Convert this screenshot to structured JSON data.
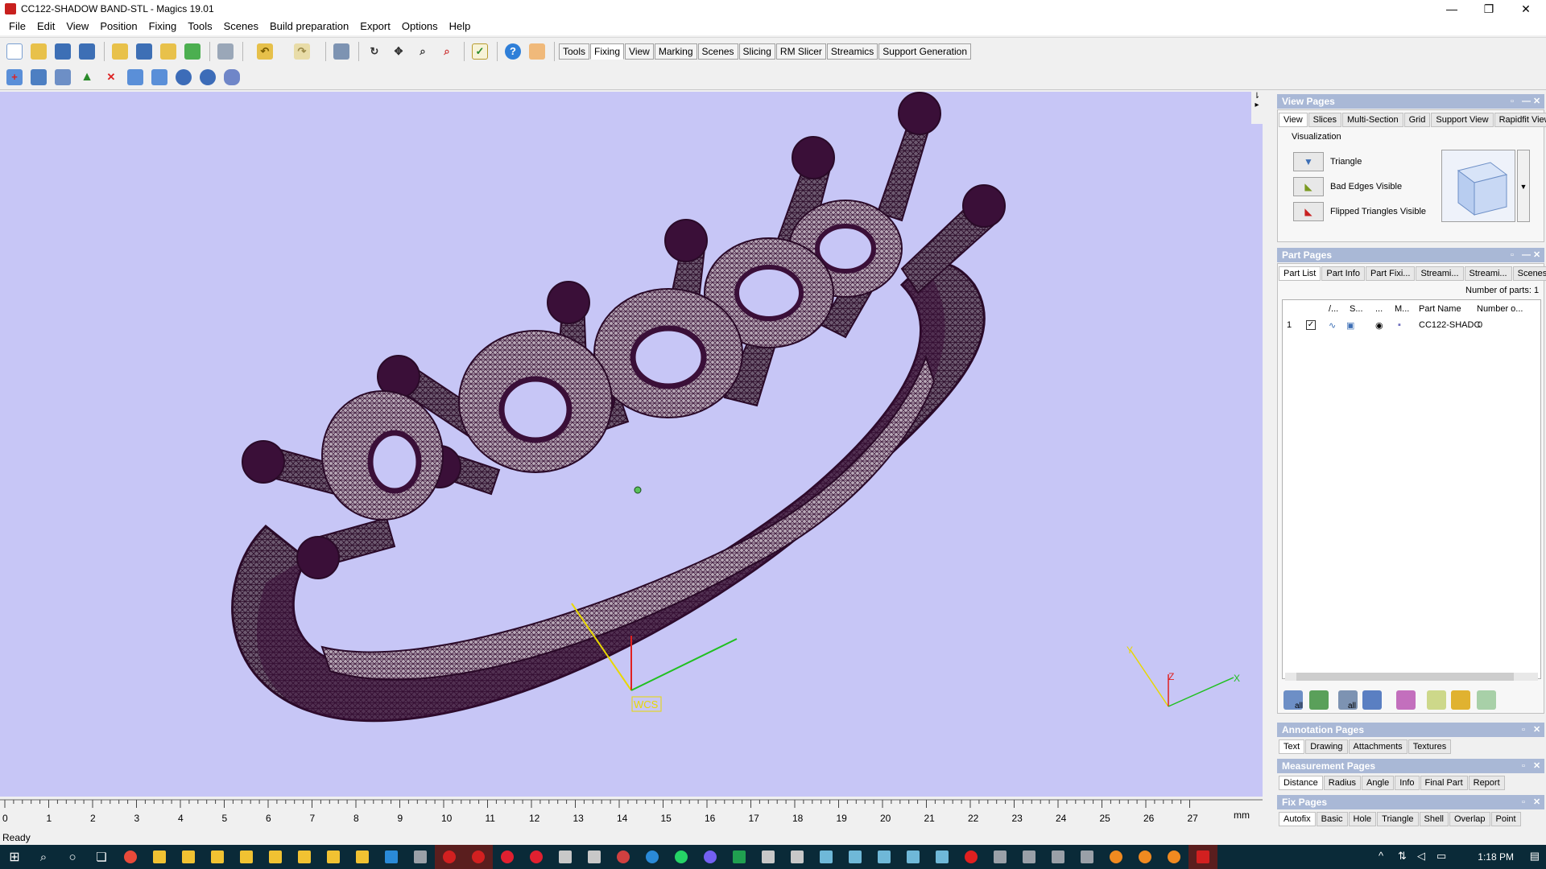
{
  "window": {
    "title": "CC122-SHADOW BAND-STL - Magics 19.01",
    "minimize": "—",
    "maximize": "❐",
    "close": "✕"
  },
  "menu": [
    "File",
    "Edit",
    "View",
    "Position",
    "Fixing",
    "Tools",
    "Scenes",
    "Build preparation",
    "Export",
    "Options",
    "Help"
  ],
  "toolbar_tabs": [
    "Tools",
    "Fixing",
    "View",
    "Marking",
    "Scenes",
    "Slicing",
    "RM Slicer",
    "Streamics",
    "Support Generation"
  ],
  "toolbar_active_tab": "Fixing",
  "viewport": {
    "wcs_label": "WCS",
    "axis_y": "Y",
    "axis_z": "Z",
    "axis_x": "X",
    "ruler_ticks": [
      "0",
      "1",
      "2",
      "3",
      "4",
      "5",
      "6",
      "7",
      "8",
      "9",
      "10",
      "11",
      "12",
      "13",
      "14",
      "15",
      "16",
      "17",
      "18",
      "19",
      "20",
      "21",
      "22",
      "23",
      "24",
      "25",
      "26",
      "27"
    ],
    "ruler_unit": "mm"
  },
  "view_pages": {
    "title": "View Pages",
    "tabs": [
      "View",
      "Slices",
      "Multi-Section",
      "Grid",
      "Support View",
      "Rapidfit View"
    ],
    "active_tab": "View",
    "group_label": "Visualization",
    "items": [
      "Triangle",
      "Bad Edges Visible",
      "Flipped Triangles Visible"
    ]
  },
  "part_pages": {
    "title": "Part Pages",
    "tabs": [
      "Part List",
      "Part Info",
      "Part Fixi...",
      "Streami...",
      "Streami...",
      "Scenes"
    ],
    "active_tab": "Part List",
    "count_label": "Number of parts: 1",
    "columns": [
      "/...",
      "S...",
      "...",
      "M...",
      "Part Name",
      "Number o..."
    ],
    "rows": [
      {
        "index": "1",
        "name": "CC122-SHADC",
        "number": "0"
      }
    ],
    "bottom_labels": [
      "all",
      "all"
    ]
  },
  "annotation_pages": {
    "title": "Annotation Pages",
    "tabs": [
      "Text",
      "Drawing",
      "Attachments",
      "Textures"
    ],
    "active_tab": "Text"
  },
  "measurement_pages": {
    "title": "Measurement Pages",
    "tabs": [
      "Distance",
      "Radius",
      "Angle",
      "Info",
      "Final Part",
      "Report"
    ],
    "active_tab": "Distance"
  },
  "fix_pages": {
    "title": "Fix Pages",
    "tabs": [
      "Autofix",
      "Basic",
      "Hole",
      "Triangle",
      "Shell",
      "Overlap",
      "Point"
    ],
    "active_tab": "Autofix"
  },
  "status": "Ready",
  "taskbar": {
    "time": "1:18 PM"
  },
  "colors": {
    "viewport_bg": "#c7c6f6",
    "mesh": "#3a0f38",
    "panel_header": "#a9b8d6",
    "taskbar": "#0a2a38"
  }
}
